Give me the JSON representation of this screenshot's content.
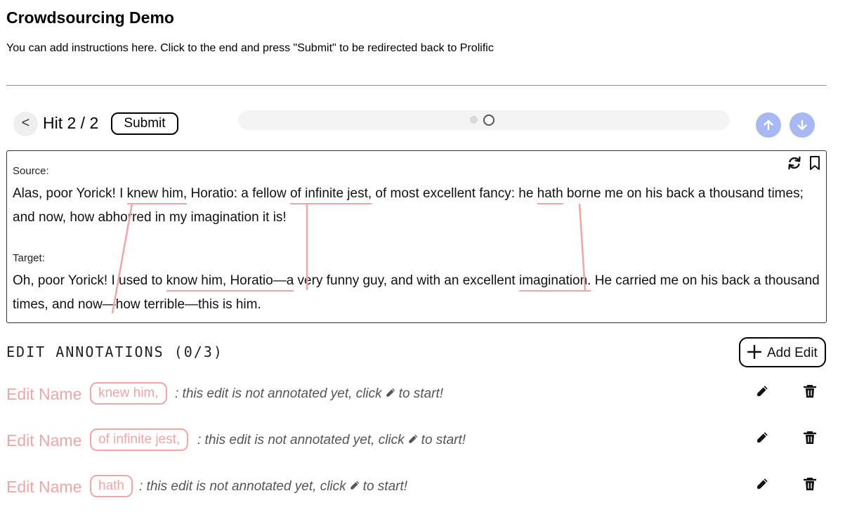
{
  "header": {
    "title": "Crowdsourcing Demo",
    "instructions": "You can add instructions here. Click to the end and press \"Submit\" to be redirected back to Prolific"
  },
  "nav": {
    "prev_label": "<",
    "hit_label": "Hit 2 / 2",
    "submit_label": "Submit"
  },
  "hit": {
    "source_label": "Source:",
    "target_label": "Target:",
    "source_segments": [
      {
        "text": "Alas, poor Yorick! I "
      },
      {
        "text": "knew him,",
        "span": true
      },
      {
        "text": " Horatio: a fellow "
      },
      {
        "text": "of infinite jest,",
        "span": true
      },
      {
        "text": " of most excellent fancy: he "
      },
      {
        "text": "hath",
        "span": true
      },
      {
        "text": " borne me on his back a thousand times; and now, how abhorred in my imagination it is!"
      }
    ],
    "target_segments": [
      {
        "text": "Oh, poor Yorick! I used to "
      },
      {
        "text": "know him, Horatio—a",
        "span": true
      },
      {
        "text": " very funny guy, and with an excellent "
      },
      {
        "text": "imagination.",
        "span": true
      },
      {
        "text": " He carried me on his back a "
      },
      {
        "text": "thousand times,",
        "span": true
      },
      {
        "text": " and now—how terrible—this is him."
      }
    ]
  },
  "annotations": {
    "heading": "EDIT ANNOTATIONS (0/3)",
    "add_label": "Add Edit",
    "rows": [
      {
        "name": "Edit Name",
        "chip": "knew him,",
        "msg_before": ": this edit is not annotated yet, click",
        "msg_after": "to start!"
      },
      {
        "name": "Edit Name",
        "chip": "of infinite jest,",
        "msg_before": ": this edit is not annotated yet, click",
        "msg_after": "to start!"
      },
      {
        "name": "Edit Name",
        "chip": "hath",
        "msg_before": ": this edit is not annotated yet, click",
        "msg_after": "to start!"
      }
    ]
  },
  "icons": {
    "prev": "chevron-left-icon",
    "up": "arrow-up-icon",
    "down": "arrow-down-icon",
    "refresh": "refresh-icon",
    "bookmark": "bookmark-icon",
    "add": "plus-icon",
    "edit": "pencil-icon",
    "delete": "trash-icon"
  },
  "colors": {
    "accent_pink": "#f0a6a6",
    "arrow_button": "#a8b8f2",
    "progress_track": "#f4f4f4"
  }
}
